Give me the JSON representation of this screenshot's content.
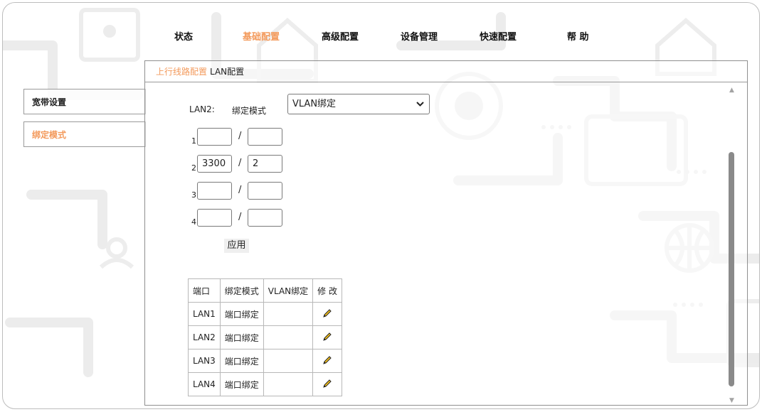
{
  "nav": {
    "items": [
      {
        "label": "状态",
        "active": false
      },
      {
        "label": "基础配置",
        "active": true
      },
      {
        "label": "高级配置",
        "active": false
      },
      {
        "label": "设备管理",
        "active": false
      },
      {
        "label": "快速配置",
        "active": false
      },
      {
        "label": "帮 助",
        "active": false
      }
    ]
  },
  "sidebar": {
    "items": [
      {
        "label": "宽带设置",
        "active": false
      },
      {
        "label": "绑定模式",
        "active": true
      }
    ]
  },
  "breadcrumb": {
    "parent": "上行线路配置",
    "current": "LAN配置"
  },
  "form": {
    "port_label": "LAN2:",
    "mode_label": "绑定模式",
    "mode_value": "VLAN绑定",
    "rows": [
      {
        "index": "1",
        "left": "",
        "right": ""
      },
      {
        "index": "2",
        "left": "3300",
        "right": "2"
      },
      {
        "index": "3",
        "left": "",
        "right": ""
      },
      {
        "index": "4",
        "left": "",
        "right": ""
      }
    ],
    "separator": "/",
    "apply_label": "应用"
  },
  "table": {
    "headers": [
      "端口",
      "绑定模式",
      "VLAN绑定",
      "修 改"
    ],
    "rows": [
      {
        "port": "LAN1",
        "mode": "端口绑定",
        "vlan": ""
      },
      {
        "port": "LAN2",
        "mode": "端口绑定",
        "vlan": ""
      },
      {
        "port": "LAN3",
        "mode": "端口绑定",
        "vlan": ""
      },
      {
        "port": "LAN4",
        "mode": "端口绑定",
        "vlan": ""
      }
    ],
    "edit_icon": "pencil-icon"
  },
  "colors": {
    "accent": "#f39a5c",
    "border": "#8f8f8f",
    "watermark": "#e9e9e9"
  }
}
